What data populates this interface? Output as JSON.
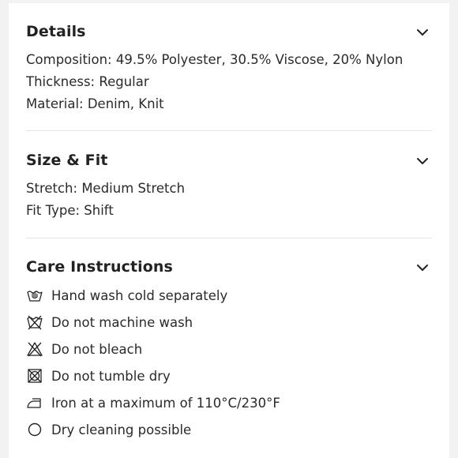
{
  "details": {
    "title": "Details",
    "lines": [
      "Composition: 49.5% Polyester, 30.5% Viscose, 20% Nylon",
      "Thickness: Regular",
      "Material: Denim, Knit"
    ]
  },
  "size_fit": {
    "title": "Size & Fit",
    "lines": [
      "Stretch: Medium Stretch",
      "Fit Type: Shift"
    ]
  },
  "care": {
    "title": "Care Instructions",
    "items": [
      {
        "icon": "hand-wash-icon",
        "label": "Hand wash cold separately"
      },
      {
        "icon": "no-machine-wash-icon",
        "label": "Do not machine wash"
      },
      {
        "icon": "no-bleach-icon",
        "label": "Do not bleach"
      },
      {
        "icon": "no-tumble-dry-icon",
        "label": "Do not tumble dry"
      },
      {
        "icon": "iron-icon",
        "label": "Iron at a maximum of 110°C/230°F"
      },
      {
        "icon": "dry-clean-icon",
        "label": "Dry cleaning possible"
      }
    ]
  }
}
